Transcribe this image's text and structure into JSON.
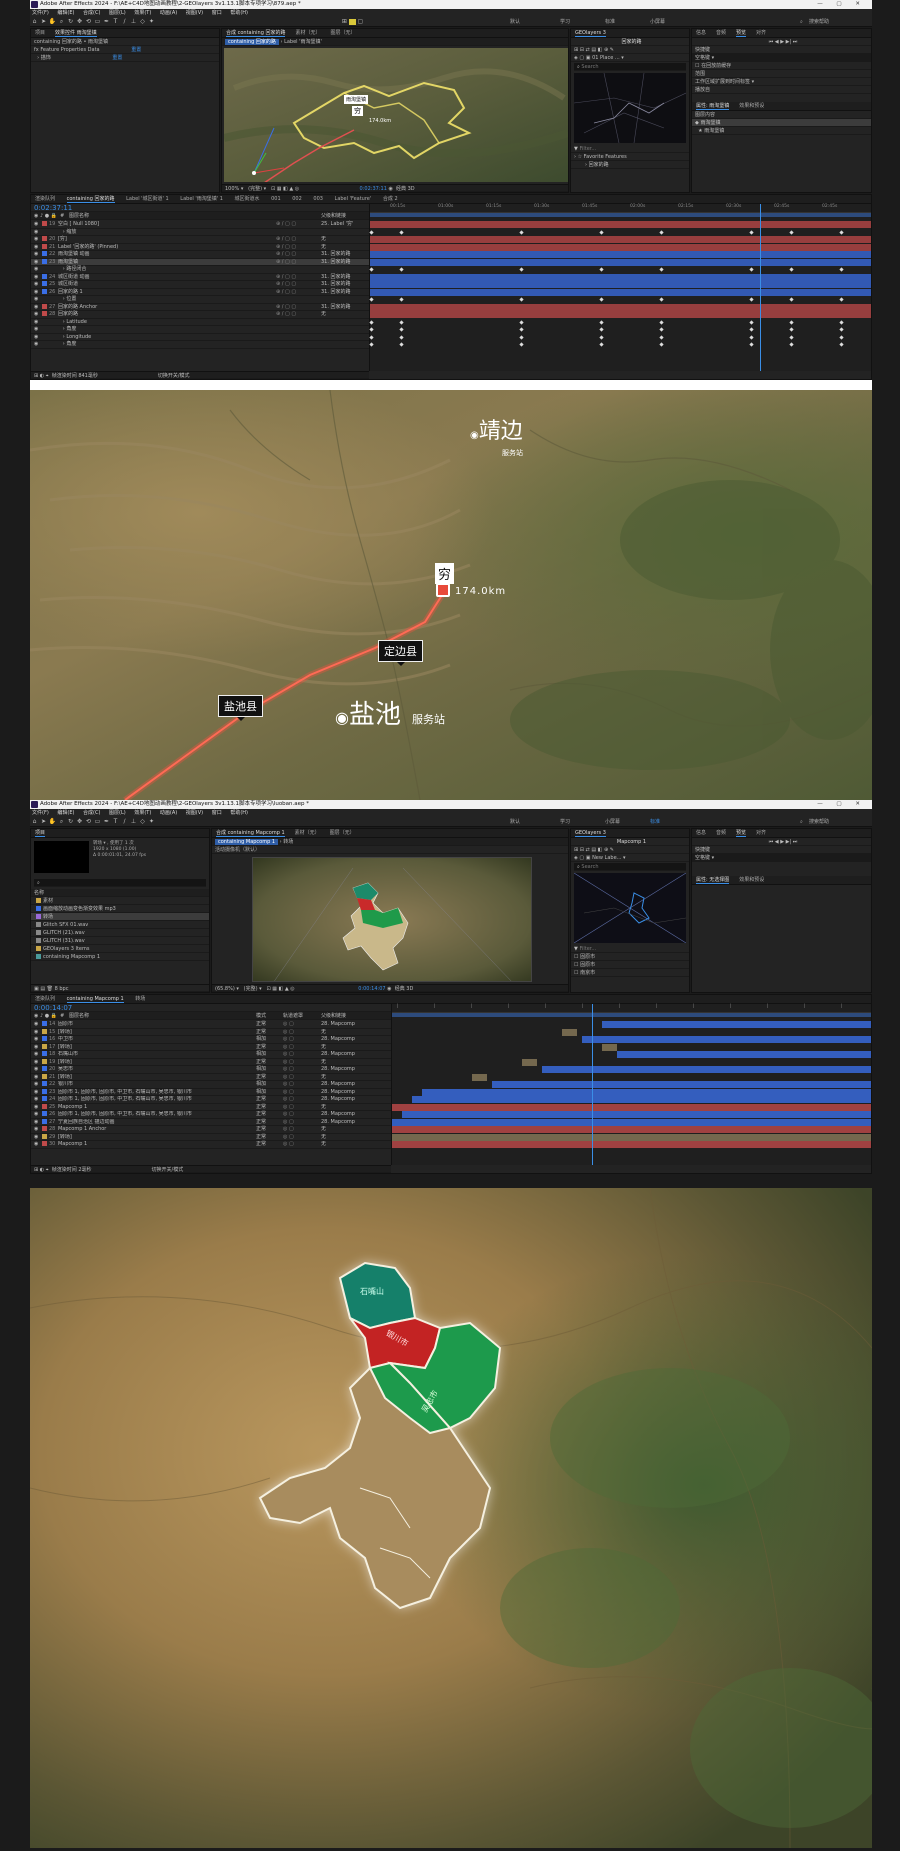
{
  "screen1": {
    "title": "Adobe After Effects 2024 - F:\\AE+C4D地图动画教程\\2-GEOlayers 3v1.13.1脚本专项学习\\879.aep *",
    "menu": [
      "文件(F)",
      "编辑(E)",
      "合成(C)",
      "图层(L)",
      "效果(T)",
      "动画(A)",
      "视图(V)",
      "窗口",
      "帮助(H)"
    ],
    "workspaces": [
      "默认",
      "学习",
      "标准",
      "小屏幕"
    ],
    "help_search": "搜索帮助",
    "project_tab": "项目",
    "effects_tab": "效果控件 雨淘堡镇",
    "effects_rows": [
      "containing 回家的路 • 雨淘堡镇",
      "Feature Properties Data",
      "描饰"
    ],
    "effects_reset": [
      "重置",
      "重置"
    ],
    "comp_tab": "合成 containing 回家的路",
    "comp_subtab": "Label '雨淘堡镇'",
    "comp_breadcrumb": "containing 回家的路",
    "material_tab": "素材（无）",
    "layer_tab": "图层（无）",
    "zoom": "100%",
    "quality": "(完整)",
    "timecode_viewer": "0:02:37:11",
    "classic3d": "经典 3D",
    "map_label": "雨淘堡镇",
    "map_poor": "穷",
    "map_km": "174.0km",
    "geo_tab": "GEOlayers 3",
    "geo_title": "回家的路",
    "geo_place": "01 Place ...",
    "geo_search": "Search",
    "geo_filter": "Filter...",
    "geo_fav": "Favorite Features",
    "geo_fav_item": "回家的路",
    "info_tabs": [
      "信息",
      "音频",
      "预览",
      "对齐"
    ],
    "shortcut_label": "快捷键",
    "shortcut_value": "空格键",
    "in_out_label": "在回放前缓存",
    "range_label": "范围",
    "range_value": "工作区域扩展到时间标签",
    "playfrom_label": "播放自",
    "props_tab": "属性: 雨淘堡镇",
    "props_tab2": "效果和预设",
    "layer_content": "图层内容",
    "layer_content_items": [
      "雨淘堡镇",
      "雨淘堡镇"
    ],
    "time_tabs": [
      "渲染队列",
      "containing 回家的路",
      "Label '城区街道' 1",
      "Label '雨淘堡镇' 1",
      "城区街道水"
    ],
    "time_tabs2": [
      "001",
      "002",
      "003",
      "Label 'Feature'",
      "合成 2"
    ],
    "timecode": "0:02:37:11",
    "column_header": "图层名称",
    "parent_header": "父级和链接",
    "layers": [
      {
        "n": "19",
        "name": "空白 [ Null 1080]",
        "parent": "25. Label '穷'"
      },
      {
        "n": "",
        "name": "缩放",
        "parent": ""
      },
      {
        "n": "20",
        "name": "[穷]",
        "parent": "无"
      },
      {
        "n": "21",
        "name": "Label '回家的路' (Pinned)",
        "parent": "无"
      },
      {
        "n": "22",
        "name": "雨淘堡镇 动画",
        "parent": "31. 回家的路"
      },
      {
        "n": "23",
        "name": "雨淘堡镇",
        "parent": "31. 回家的路"
      },
      {
        "n": "",
        "name": "路径闭合",
        "parent": ""
      },
      {
        "n": "24",
        "name": "城区街道 动画",
        "parent": "31. 回家的路"
      },
      {
        "n": "25",
        "name": "城区街道",
        "parent": "31. 回家的路"
      },
      {
        "n": "26",
        "name": "回家的路 1",
        "parent": "31. 回家的路"
      },
      {
        "n": "",
        "name": "位置",
        "parent": ""
      },
      {
        "n": "27",
        "name": "回家的路 Anchor",
        "parent": "31. 回家的路"
      },
      {
        "n": "28",
        "name": "回家的路",
        "parent": "无"
      },
      {
        "n": "",
        "name": "Latitude",
        "parent": ""
      },
      {
        "n": "",
        "name": "角度",
        "parent": ""
      },
      {
        "n": "",
        "name": "Longitude",
        "parent": ""
      },
      {
        "n": "",
        "name": "角度",
        "parent": ""
      }
    ],
    "ruler": [
      "00:15s",
      "01:00s",
      "01:15s",
      "01:30s",
      "01:45s",
      "02:00s",
      "02:15s",
      "02:30s",
      "02:45s",
      "02:45s"
    ],
    "footer_render": "帧渲染时间 841毫秒",
    "footer_mode": "切换开关/模式"
  },
  "map1": {
    "jingbian": "靖边",
    "jingbian_sub": "服务站",
    "poor": "穷",
    "km": "174.0km",
    "dingbian": "定边县",
    "yanchi_county": "盐池县",
    "yanchi_big": "盐池",
    "yanchi_sub": "服务站"
  },
  "screen2": {
    "title": "Adobe After Effects 2024 - F:\\AE+C4D地图动画教程\\2-GEOlayers 3v1.13.1脚本专项学习\\luoban.aep *",
    "menu": [
      "文件(F)",
      "编辑(E)",
      "合成(C)",
      "图层(L)",
      "效果(T)",
      "动画(A)",
      "视图(V)",
      "窗口",
      "帮助(H)"
    ],
    "workspaces": [
      "默认",
      "学习",
      "小屏幕",
      "标准"
    ],
    "help_search": "搜索帮助",
    "project_tab": "项目",
    "proj_info": [
      "转场 ▾ , 使用了 1 次",
      "1920 x 1080 (1.00)",
      "Δ 0:00:01:01, 24.07 fps"
    ],
    "proj_search": "",
    "proj_col": "名称",
    "proj_items": [
      "素材",
      "画面缩放动画变色渐变效果 mp3",
      "转场",
      "Glitch SFX 01.wav",
      "GLITCH (21).wav",
      "GLITCH (31).wav",
      "GEOlayers 3 Items",
      "containing Mapcomp 1"
    ],
    "proj_bpc": "8 bpc",
    "comp_tab": "合成 containing Mapcomp 1",
    "comp_subtab": "转场",
    "comp_breadcrumb": "containing Mapcomp 1",
    "active_camera": "活动摄像机（默认）",
    "material_tab": "素材（无）",
    "layer_tab": "图层（无）",
    "zoom": "(65.8%)",
    "quality": "(完整)",
    "timecode_viewer": "0:00:14:07",
    "classic3d": "经典 3D",
    "geo_tab": "GEOlayers 3",
    "geo_title": "Mapcomp 1",
    "geo_place": "New Labe...",
    "geo_search": "Search",
    "geo_filter": "Filter...",
    "geo_list": [
      "固原市",
      "固原市",
      "南京市"
    ],
    "info_tabs": [
      "信息",
      "音频",
      "预览",
      "对齐"
    ],
    "shortcut_label": "快捷键",
    "shortcut_value": "空格键",
    "props_tab": "属性: 无选择图",
    "props_tab2": "效果和预设",
    "time_tabs": [
      "渲染队列",
      "containing Mapcomp 1",
      "转场"
    ],
    "timecode": "0:00:14:07",
    "column_header": "图层名称",
    "mode_header": "模式",
    "trkmat_header": "轨道遮罩",
    "parent_header": "父级和链接",
    "layers": [
      {
        "n": "14",
        "name": "固原市",
        "mode": "正常",
        "parent": "28. Mapcomp"
      },
      {
        "n": "15",
        "name": "[转场]",
        "mode": "正常",
        "parent": "无"
      },
      {
        "n": "16",
        "name": "中卫市",
        "mode": "相加",
        "parent": "28. Mapcomp"
      },
      {
        "n": "17",
        "name": "[转场]",
        "mode": "正常",
        "parent": "无"
      },
      {
        "n": "18",
        "name": "石嘴山市",
        "mode": "相加",
        "parent": "28. Mapcomp"
      },
      {
        "n": "19",
        "name": "[转场]",
        "mode": "正常",
        "parent": "无"
      },
      {
        "n": "20",
        "name": "吴忠市",
        "mode": "相加",
        "parent": "28. Mapcomp"
      },
      {
        "n": "21",
        "name": "[转场]",
        "mode": "正常",
        "parent": "无"
      },
      {
        "n": "22",
        "name": "银川市",
        "mode": "相加",
        "parent": "28. Mapcomp"
      },
      {
        "n": "23",
        "name": "固原市 1, 固原市, 固原市, 中卫市, 石嘴山市, 吴忠市, 银川市",
        "mode": "相加",
        "parent": "28. Mapcomp"
      },
      {
        "n": "24",
        "name": "固原市 1, 固原市, 固原市, 中卫市, 石嘴山市, 吴忠市, 银川市",
        "mode": "正常",
        "parent": "28. Mapcomp"
      },
      {
        "n": "25",
        "name": "Mapcomp 1",
        "mode": "正常",
        "parent": "无"
      },
      {
        "n": "26",
        "name": "固原市 1, 固原市, 固原市, 中卫市, 石嘴山市, 吴忠市, 银川市",
        "mode": "正常",
        "parent": "28. Mapcomp"
      },
      {
        "n": "27",
        "name": "宁夏回族自治区 描边动画",
        "mode": "正常",
        "parent": "28. Mapcomp"
      },
      {
        "n": "28",
        "name": "Mapcomp 1 Anchor",
        "mode": "正常",
        "parent": "无"
      },
      {
        "n": "29",
        "name": "[转场]",
        "mode": "正常",
        "parent": "无"
      },
      {
        "n": "30",
        "name": "Mapcomp 1",
        "mode": "正常",
        "parent": "无"
      }
    ],
    "footer_render": "帧渲染时间 2毫秒",
    "footer_mode": "切换开关/模式"
  },
  "map2": {
    "shizuishan": "石嘴山",
    "yinchuan": "银川市",
    "wuzhong": "吴忠市"
  }
}
